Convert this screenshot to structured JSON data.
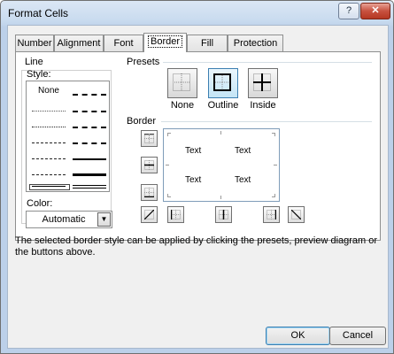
{
  "window": {
    "title": "Format Cells",
    "help_label": "?",
    "close_label": "✕"
  },
  "tabs": [
    {
      "label": "Number"
    },
    {
      "label": "Alignment"
    },
    {
      "label": "Font"
    },
    {
      "label": "Border",
      "active": true
    },
    {
      "label": "Fill"
    },
    {
      "label": "Protection"
    }
  ],
  "line_group": {
    "title": "Line",
    "style_label": "Style:",
    "none_label": "None",
    "color_label": "Color:",
    "color_value": "Automatic"
  },
  "presets_group": {
    "title": "Presets",
    "items": [
      {
        "label": "None"
      },
      {
        "label": "Outline"
      },
      {
        "label": "Inside"
      }
    ]
  },
  "border_group": {
    "title": "Border",
    "preview_texts": [
      "Text",
      "Text",
      "Text",
      "Text"
    ]
  },
  "hint": "The selected border style can be applied by clicking the presets, preview diagram or the buttons above.",
  "buttons": {
    "ok": "OK",
    "cancel": "Cancel"
  },
  "colors": {
    "accent": "#3c7fb1",
    "preset_hover": "#9fd5f3"
  }
}
